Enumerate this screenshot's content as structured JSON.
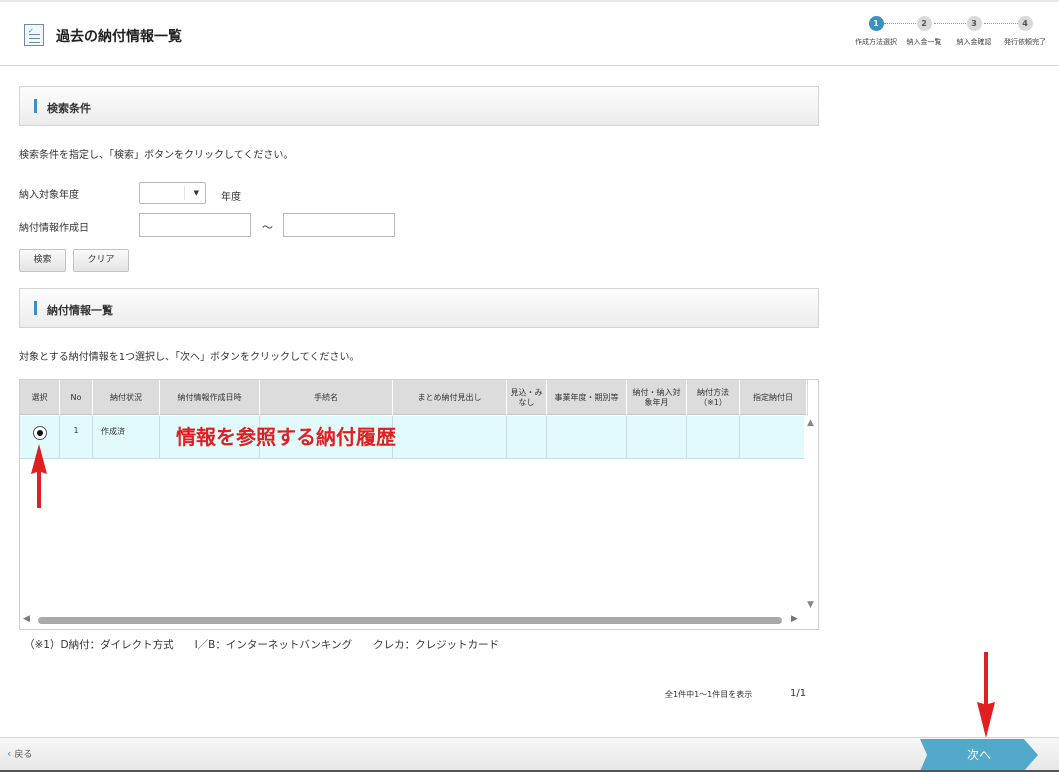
{
  "header": {
    "title": "過去の納付情報一覧",
    "steps": [
      {
        "num": "1",
        "label": "作成方法選択",
        "active": true
      },
      {
        "num": "2",
        "label": "納入金一覧",
        "active": false
      },
      {
        "num": "3",
        "label": "納入金確認",
        "active": false
      },
      {
        "num": "4",
        "label": "発行依頼完了",
        "active": false
      }
    ]
  },
  "search": {
    "section_title": "検索条件",
    "description": "検索条件を指定し、「検索」ボタンをクリックしてください。",
    "year_label": "納入対象年度",
    "year_value": "",
    "year_unit": "年度",
    "date_label": "納付情報作成日",
    "date_from": "",
    "date_to": "",
    "tilde": "～",
    "search_button": "検索",
    "clear_button": "クリア"
  },
  "list": {
    "section_title": "納付情報一覧",
    "description": "対象とする納付情報を1つ選択し、「次へ」ボタンをクリックしてください。",
    "columns": [
      "選択",
      "No",
      "納付状況",
      "納付情報作成日時",
      "手続名",
      "まとめ納付見出し",
      "見込・みなし",
      "事業年度・期別等",
      "納付・納入対象年月",
      "納付方法（※1）",
      "指定納付日"
    ],
    "rows": [
      {
        "selected": true,
        "no": "1",
        "status": "作成済",
        "created": "",
        "procedure": "",
        "summary": "",
        "estimate": "",
        "period": "",
        "target_month": "",
        "method": "",
        "due_date": ""
      }
    ],
    "annotation": "情報を参照する納付履歴",
    "footnote": "（※1）D納付：ダイレクト方式　　I／B：インターネットバンキング　　クレカ：クレジットカード",
    "pager_info": "全1件中1～1件目を表示",
    "pager_page": "1/1"
  },
  "footer": {
    "back_label": "戻る",
    "next_label": "次へ"
  },
  "colors": {
    "accent": "#3a8fc4",
    "next_button": "#53a9c9",
    "selected_row": "#e1fbfd",
    "annotation": "#e02020"
  }
}
